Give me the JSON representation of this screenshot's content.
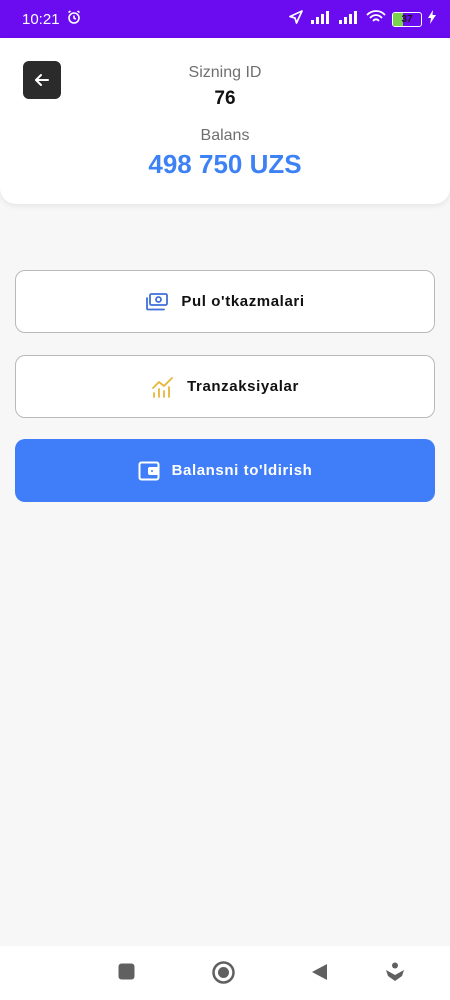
{
  "status_bar": {
    "time": "10:21",
    "battery_level": "37",
    "battery_fraction": 0.37
  },
  "header": {
    "id_label": "Sizning ID",
    "id_value": "76",
    "balance_label": "Balans",
    "balance_value": "498 750 UZS"
  },
  "actions": {
    "transfers_label": "Pul o'tkazmalari",
    "transactions_label": "Tranzaksiyalar",
    "topup_label": "Balansni to'ldirish"
  },
  "colors": {
    "status_bar": "#6a0bf0",
    "accent": "#3f7ef8",
    "balance_text": "#3d82f5",
    "transactions_icon": "#e7b63a"
  },
  "icons": {
    "back": "arrow-left-icon",
    "transfers": "money-bills-icon",
    "transactions": "chart-trend-icon",
    "topup": "wallet-icon"
  }
}
